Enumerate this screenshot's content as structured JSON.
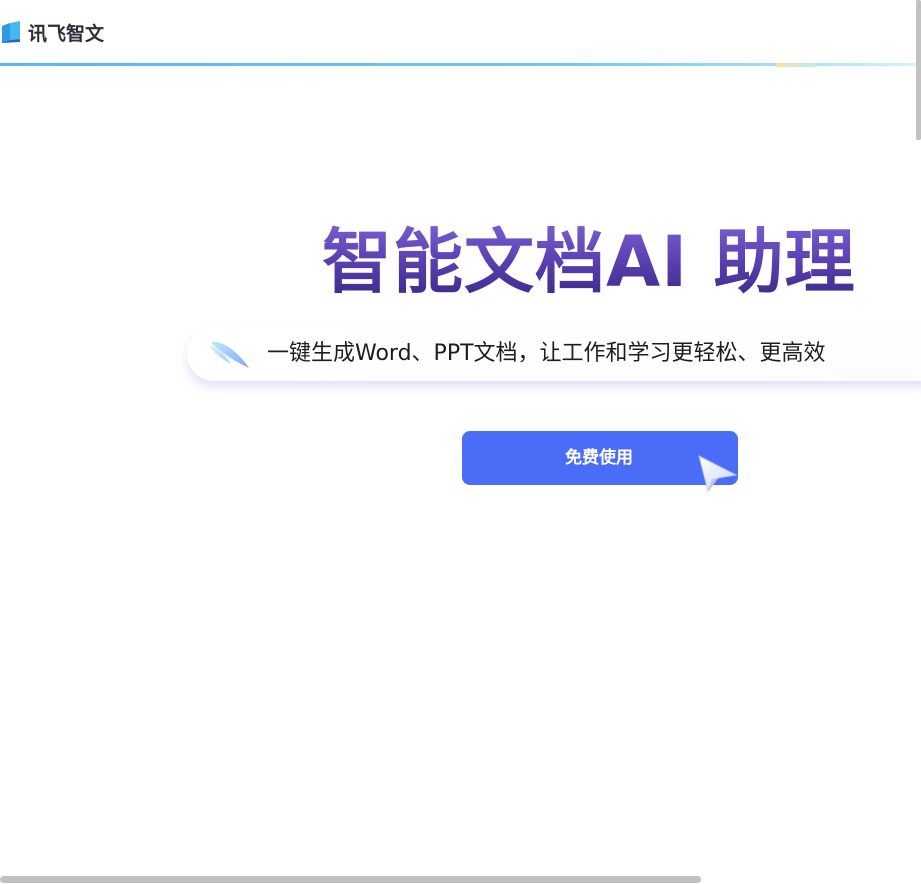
{
  "header": {
    "logo_text": "讯飞智文",
    "logo_icon": "book-logo-icon"
  },
  "hero": {
    "title": "智能文档AI 助理",
    "subtitle": "一键生成Word、PPT文档，让工作和学习更轻松、更高效",
    "subtitle_icon": "feather-icon",
    "cta_label": "免费使用",
    "cta_icon": "cursor-pointer-icon"
  },
  "colors": {
    "accent": "#4a6cf7",
    "title_gradient_top": "#7a5fd2",
    "title_gradient_bottom": "#3a2886",
    "header_line": "#5bb8ec"
  }
}
